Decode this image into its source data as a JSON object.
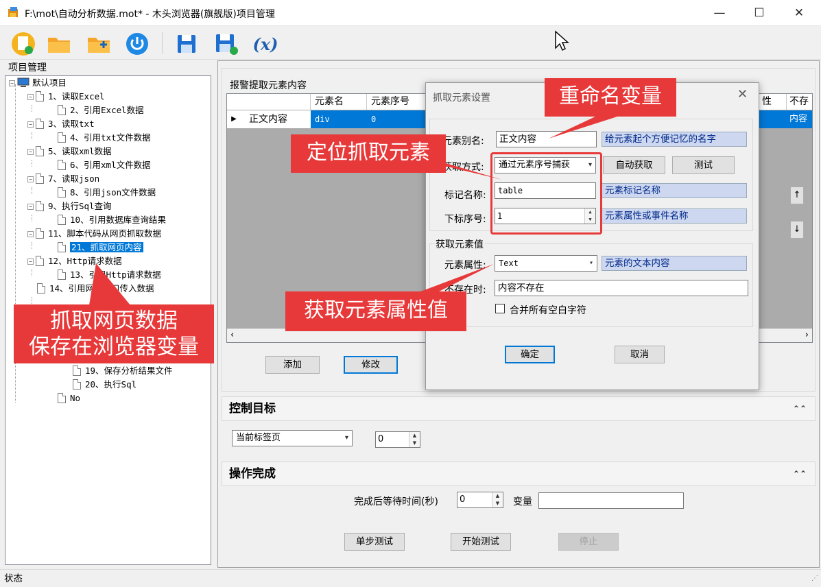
{
  "window": {
    "title": "F:\\mot\\自动分析数据.mot* - 木头浏览器(旗舰版)项目管理",
    "min": "—",
    "max": "☐",
    "close": "✕"
  },
  "tree": {
    "header": "项目管理",
    "items": [
      {
        "label": "默认项目"
      },
      {
        "label": "1、读取Excel"
      },
      {
        "label": "2、引用Excel数据"
      },
      {
        "label": "3、读取txt"
      },
      {
        "label": "4、引用txt文件数据"
      },
      {
        "label": "5、读取xml数据"
      },
      {
        "label": "6、引用xml文件数据"
      },
      {
        "label": "7、读取json"
      },
      {
        "label": "8、引用json文件数据"
      },
      {
        "label": "9、执行Sql查询"
      },
      {
        "label": "10、引用数据库查询结果"
      },
      {
        "label": "11、脚本代码从网页抓取数据"
      },
      {
        "label": "21、抓取网页内容"
      },
      {
        "label": "12、Http请求数据"
      },
      {
        "label": "13、引用Http请求数据"
      },
      {
        "label": "14、引用网络接口传入数据"
      },
      {
        "label": "19、保存分析结果文件"
      },
      {
        "label": "20、执行Sql"
      },
      {
        "label": "No"
      }
    ]
  },
  "extract": {
    "group_label": "报警提取元素内容",
    "columns": [
      "元素名",
      "元素序号",
      "性",
      "不存"
    ],
    "row": {
      "name": "正文内容",
      "tag": "div",
      "index": "0",
      "last": "内容"
    },
    "add": "添加",
    "modify": "修改"
  },
  "control": {
    "header": "控制目标",
    "tab_select": "当前标签页",
    "tab_index": "0"
  },
  "done": {
    "header": "操作完成",
    "wait_label": "完成后等待时间(秒)",
    "wait_value": "0",
    "var_label": "变量",
    "var_value": ""
  },
  "buttons": {
    "step": "单步测试",
    "start": "开始测试",
    "stop": "停止"
  },
  "dialog": {
    "title": "抓取元素设置",
    "alias_label": "元素别名:",
    "alias_value": "正文内容",
    "alias_hint": "给元素起个方便记忆的名字",
    "method_label": "获取方式:",
    "method_value": "通过元素序号捕获",
    "auto": "自动获取",
    "test": "测试",
    "tag_label": "标记名称:",
    "tag_value": "table",
    "tag_hint": "元素标记名称",
    "index_label": "下标序号:",
    "index_value": "1",
    "index_hint": "元素属性或事件名称",
    "group2": "获取元素值",
    "attr_label": "元素属性:",
    "attr_value": "Text",
    "attr_hint": "元素的文本内容",
    "missing_label": "不存在时:",
    "missing_value": "内容不存在",
    "merge": "合并所有空白字符",
    "ok": "确定",
    "cancel": "取消"
  },
  "callouts": {
    "rename": "重命名变量",
    "locate": "定位抓取元素",
    "attr": "获取元素属性值",
    "grab_line1": "抓取网页数据",
    "grab_line2": "保存在浏览器变量"
  },
  "status": "状态",
  "colors": {
    "callout": "#e8393a",
    "selection": "#0078d7",
    "highlight_box": "#e8393a"
  }
}
